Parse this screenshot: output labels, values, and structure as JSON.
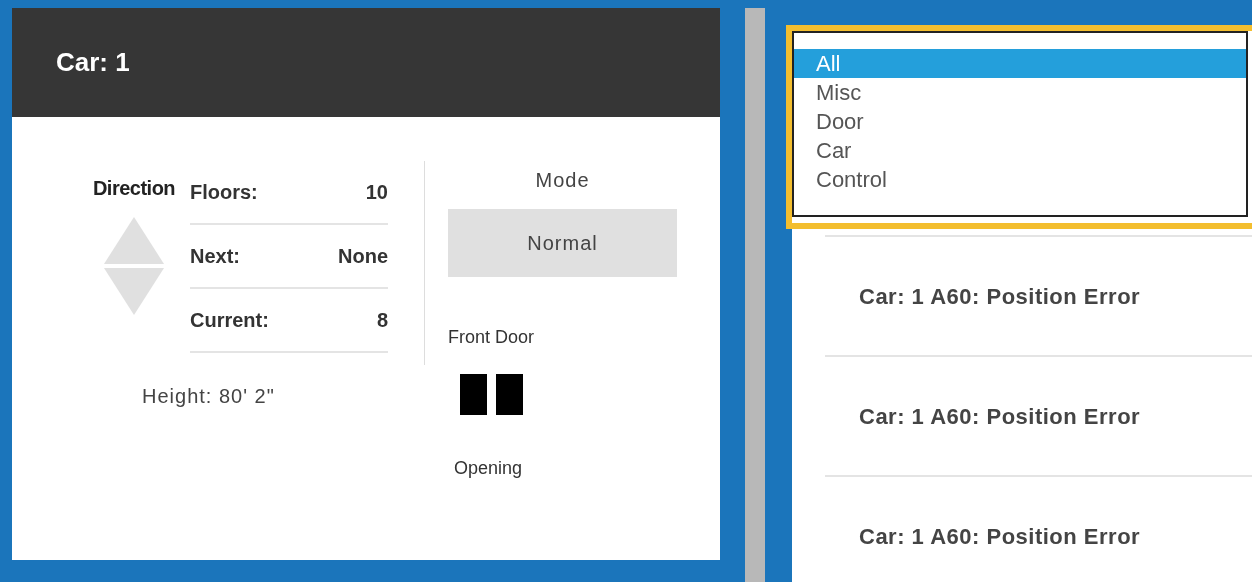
{
  "car_panel": {
    "title": "Car: 1",
    "direction_label": "Direction",
    "stats": [
      {
        "label": "Floors:",
        "value": "10"
      },
      {
        "label": "Next:",
        "value": "None"
      },
      {
        "label": "Current:",
        "value": "8"
      }
    ],
    "height": "Height: 80' 2\"",
    "mode_label": "Mode",
    "mode": "Normal",
    "door_label": "Front Door",
    "door_state": "Opening"
  },
  "fault_list": [
    "Car: 1 A60: Position Error",
    "Car: 1 A60: Position Error",
    "Car: 1 A60: Position Error"
  ],
  "filter_dropdown": {
    "options": [
      {
        "label": "All",
        "selected": true
      },
      {
        "label": "Misc",
        "selected": false
      },
      {
        "label": "Door",
        "selected": false
      },
      {
        "label": "Car",
        "selected": false
      },
      {
        "label": "Control",
        "selected": false
      }
    ]
  }
}
